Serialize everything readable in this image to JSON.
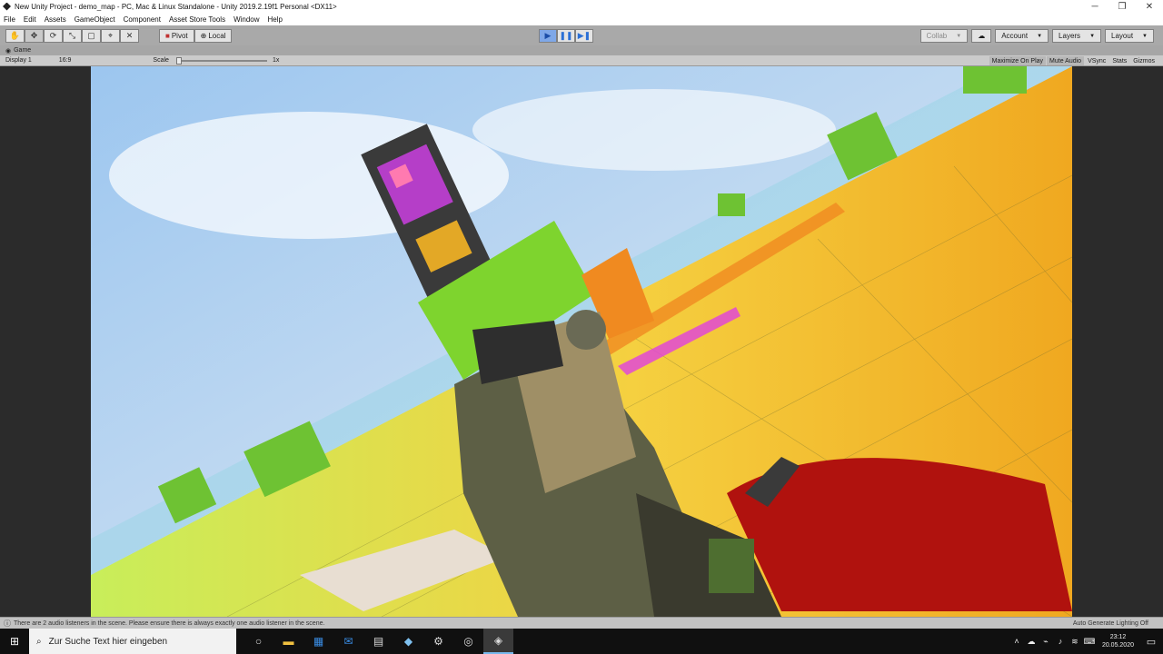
{
  "window": {
    "title": "New Unity Project - demo_map - PC, Mac & Linux Standalone - Unity 2019.2.19f1 Personal <DX11>",
    "minimize": "─",
    "maximize": "❐",
    "close": "✕"
  },
  "menu": [
    "File",
    "Edit",
    "Assets",
    "GameObject",
    "Component",
    "Asset Store Tools",
    "Window",
    "Help"
  ],
  "toolbar": {
    "tools": [
      {
        "name": "hand-tool",
        "icon": "✋"
      },
      {
        "name": "move-tool",
        "icon": "✥"
      },
      {
        "name": "rotate-tool",
        "icon": "⟳"
      },
      {
        "name": "scale-tool",
        "icon": "⤡"
      },
      {
        "name": "rect-tool",
        "icon": "▢"
      },
      {
        "name": "transform-tool",
        "icon": "⌖"
      },
      {
        "name": "custom-tool",
        "icon": "✕"
      }
    ],
    "pivot": "Pivot",
    "local": "Local",
    "play_icons": {
      "play": "▶",
      "pause": "❚❚",
      "step": "▶❚"
    },
    "collab": "Collab",
    "cloud": "☁",
    "account": "Account",
    "layers": "Layers",
    "layout": "Layout"
  },
  "game_tab": {
    "label": "Game"
  },
  "game_bar": {
    "display": "Display 1",
    "aspect": "16:9",
    "scale_label": "Scale",
    "scale_value": "1x",
    "maximize_on_play": "Maximize On Play",
    "mute_audio": "Mute Audio",
    "vsync": "VSync",
    "stats": "Stats",
    "gizmos": "Gizmos"
  },
  "status": {
    "message": "There are 2 audio listeners in the scene. Please ensure there is always exactly one audio listener in the scene.",
    "right": "Auto Generate Lighting Off"
  },
  "taskbar": {
    "search_placeholder": "Zur Suche Text hier eingeben",
    "time": "23:12",
    "date": "20.05.2020"
  },
  "colors": {
    "sky": "#7fb3e8",
    "ground": "#f2c23a",
    "grass": "#9fe34a",
    "blood": "#b0120e",
    "play_active": "#7fa8e8"
  }
}
